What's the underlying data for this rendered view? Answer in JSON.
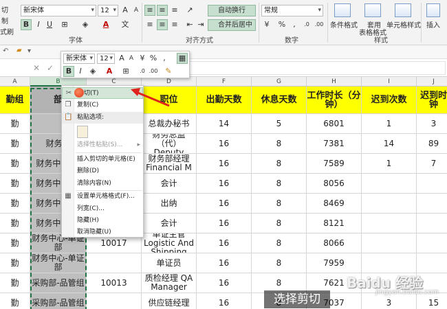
{
  "ribbon": {
    "cut_label": "切",
    "copy_label": "制",
    "format_painter_label": "式刷",
    "font_name": "新宋体",
    "font_size": "12",
    "bold": "B",
    "italic": "I",
    "underline": "U",
    "font_group": "字体",
    "align_group": "对齐方式",
    "wrap_text": "自动换行",
    "merge_center": "合并后居中",
    "number_format": "常规",
    "number_group": "数字",
    "cond_format": "条件格式",
    "table_format": "套用",
    "table_format2": "表格格式",
    "cell_style": "单元格样式",
    "style_group": "样式",
    "insert": "插入",
    "percent": "%",
    "comma": ","
  },
  "formula_bar": {
    "cancel": "✕",
    "enter": "✓"
  },
  "mini_toolbar": {
    "font_name": "新宋体",
    "font_size": "12",
    "bold": "B",
    "italic": "I",
    "percent": "%",
    "comma": ","
  },
  "columns": [
    "A",
    "B",
    "C",
    "D",
    "F",
    "G",
    "H",
    "I",
    "J"
  ],
  "header_row": [
    "勤组",
    "部",
    "",
    "职位",
    "出勤天数",
    "休息天数",
    "工作时长（分钟）",
    "迟到次数",
    "迟到时钟"
  ],
  "rows": [
    {
      "a": "勤",
      "b": "",
      "c": "",
      "d": "总裁办秘书",
      "f": "14",
      "g": "5",
      "h": "6801",
      "i": "1",
      "j": "3"
    },
    {
      "a": "勤",
      "b": "财务中",
      "c": "",
      "d": "财务总监（代） Deputy",
      "f": "16",
      "g": "8",
      "h": "7381",
      "i": "14",
      "j": "89"
    },
    {
      "a": "勤",
      "b": "财务中心-部",
      "c": "",
      "d": "财务部经理 Financial M",
      "f": "16",
      "g": "8",
      "h": "7589",
      "i": "1",
      "j": "7"
    },
    {
      "a": "勤",
      "b": "财务中心-部",
      "c": "",
      "d": "会计",
      "f": "16",
      "g": "8",
      "h": "8056",
      "i": "",
      "j": ""
    },
    {
      "a": "勤",
      "b": "财务中心-部",
      "c": "",
      "d": "出纳",
      "f": "16",
      "g": "8",
      "h": "8469",
      "i": "",
      "j": ""
    },
    {
      "a": "勤",
      "b": "财务中心-部",
      "c": "",
      "d": "会计",
      "f": "16",
      "g": "8",
      "h": "8121",
      "i": "",
      "j": ""
    },
    {
      "a": "勤",
      "b": "财务中心-单证部",
      "c": "10017",
      "d": "单证主管 Logistic And Shipping",
      "f": "16",
      "g": "8",
      "h": "8066",
      "i": "",
      "j": ""
    },
    {
      "a": "勤",
      "b": "财务中心-单证部",
      "c": "",
      "d": "单证员",
      "f": "16",
      "g": "8",
      "h": "7959",
      "i": "",
      "j": ""
    },
    {
      "a": "勤",
      "b": "采购部-品管组",
      "c": "10013",
      "d": "质检经理 QA Manager",
      "f": "16",
      "g": "8",
      "h": "7621",
      "i": "",
      "j": ""
    },
    {
      "a": "勤",
      "b": "采购部-品管组",
      "c": "",
      "d": "供应链经理",
      "f": "16",
      "g": "8",
      "h": "7037",
      "i": "3",
      "j": "15"
    }
  ],
  "context_menu": {
    "cut": "剪切(T)",
    "copy": "复制(C)",
    "paste_options": "粘贴选项:",
    "paste_special": "选择性粘贴(S)...",
    "insert_copied": "插入剪切的单元格(E)",
    "delete": "删除(D)",
    "clear": "清除内容(N)",
    "format_cells": "设置单元格格式(F)...",
    "column_width": "列宽(C)...",
    "hide": "隐藏(H)",
    "unhide": "取消隐藏(U)"
  },
  "caption": "选择剪切",
  "watermark": "Baidu 经验",
  "watermark_sub": "jingyan.baidu.com",
  "colors": {
    "accent": "#217346",
    "header_yellow": "#ffff00",
    "arrow_red": "#e0231b"
  }
}
